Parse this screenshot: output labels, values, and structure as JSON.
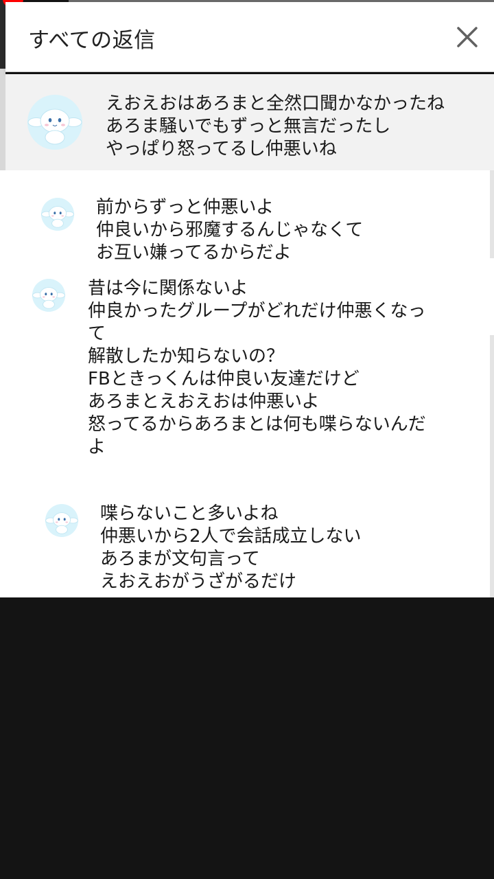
{
  "header": {
    "title": "すべての返信",
    "close_icon": "close-icon"
  },
  "parent_comment": {
    "avatar_icon": "cinnamoroll-avatar-icon",
    "text": "えおえおはあろまと全然口聞かなかったね\nあろま騒いでもずっと無言だったし\nやっぱり怒ってるし仲悪いね"
  },
  "replies": [
    {
      "avatar_icon": "cinnamoroll-avatar-icon",
      "text": "前からずっと仲悪いよ\n仲良いから邪魔するんじゃなくて\nお互い嫌ってるからだよ"
    },
    {
      "avatar_icon": "cinnamoroll-avatar-icon",
      "text": "昔は今に関係ないよ\n仲良かったグループがどれだけ仲悪くなっ\nて\n解散したか知らないの？\nFBときっくんは仲良い友達だけど\nあろまとえおえおは仲悪いよ\n怒ってるからあろまとは何も喋らないんだ\nよ"
    },
    {
      "avatar_icon": "cinnamoroll-avatar-icon",
      "text": "喋らないこと多いよね\n仲悪いから2人で会話成立しない\nあろまが文句言って\nえおえおがうざがるだけ"
    }
  ],
  "colors": {
    "header_bg": "#ffffff",
    "parent_bg": "#f2f2f2",
    "replies_bg": "#ffffff",
    "avatar_bg": "#d9f3fb",
    "backdrop": "#141414",
    "indicator": "#ff0000"
  }
}
